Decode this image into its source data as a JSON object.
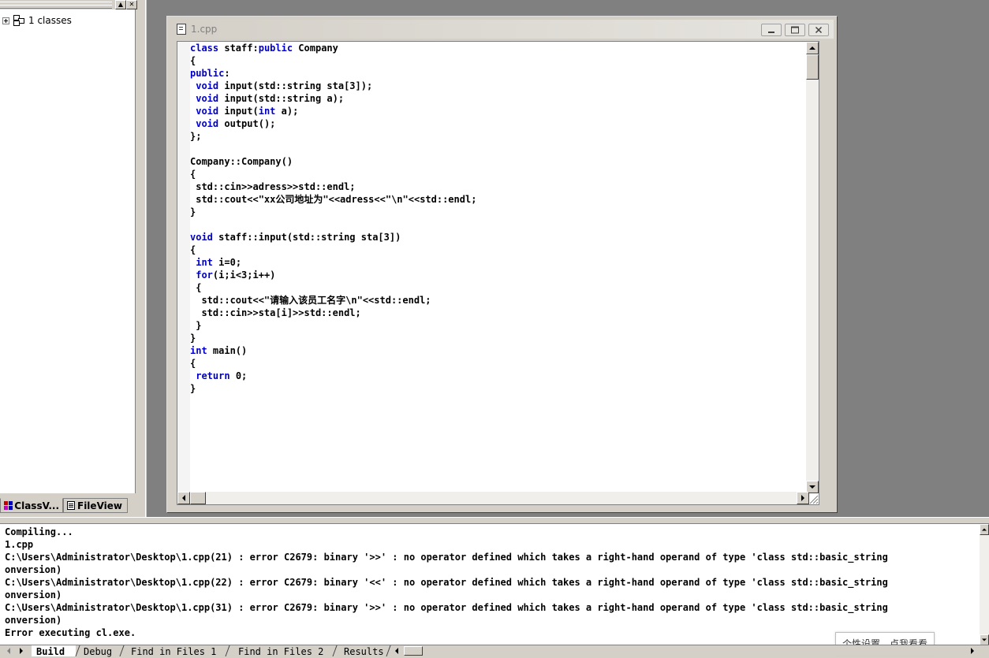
{
  "workspace": {
    "tree_root_label": "1 classes",
    "tabs": [
      {
        "label": "ClassV..."
      },
      {
        "label": "FileView"
      }
    ],
    "close_glyph": "✕",
    "restore_glyph": "▲"
  },
  "editor": {
    "window_title": "1.cpp",
    "code_lines": [
      [
        {
          "t": "class ",
          "k": true
        },
        {
          "t": "staff:",
          "k": false
        },
        {
          "t": "public",
          "k": true
        },
        {
          "t": " Company",
          "k": false
        }
      ],
      [
        {
          "t": "{",
          "k": false
        }
      ],
      [
        {
          "t": "public",
          "k": true
        },
        {
          "t": ":",
          "k": false
        }
      ],
      [
        {
          "t": " ",
          "k": false
        },
        {
          "t": "void",
          "k": true
        },
        {
          "t": " input(std::string sta[3]);",
          "k": false
        }
      ],
      [
        {
          "t": " ",
          "k": false
        },
        {
          "t": "void",
          "k": true
        },
        {
          "t": " input(std::string a);",
          "k": false
        }
      ],
      [
        {
          "t": " ",
          "k": false
        },
        {
          "t": "void",
          "k": true
        },
        {
          "t": " input(",
          "k": false
        },
        {
          "t": "int",
          "k": true
        },
        {
          "t": " a);",
          "k": false
        }
      ],
      [
        {
          "t": " ",
          "k": false
        },
        {
          "t": "void",
          "k": true
        },
        {
          "t": " output();",
          "k": false
        }
      ],
      [
        {
          "t": "};",
          "k": false
        }
      ],
      [
        {
          "t": "",
          "k": false
        }
      ],
      [
        {
          "t": "Company::Company()",
          "k": false
        }
      ],
      [
        {
          "t": "{",
          "k": false
        }
      ],
      [
        {
          "t": " std::cin>>adress>>std::endl;",
          "k": false
        }
      ],
      [
        {
          "t": " std::cout<<\"xx公司地址为\"<<adress<<\"\\n\"<<std::endl;",
          "k": false
        }
      ],
      [
        {
          "t": "}",
          "k": false
        }
      ],
      [
        {
          "t": "",
          "k": false
        }
      ],
      [
        {
          "t": "void",
          "k": true
        },
        {
          "t": " staff::input(std::string sta[3])",
          "k": false
        }
      ],
      [
        {
          "t": "{",
          "k": false
        }
      ],
      [
        {
          "t": " ",
          "k": false
        },
        {
          "t": "int",
          "k": true
        },
        {
          "t": " i=0;",
          "k": false
        }
      ],
      [
        {
          "t": " ",
          "k": false
        },
        {
          "t": "for",
          "k": true
        },
        {
          "t": "(i;i<3;i++)",
          "k": false
        }
      ],
      [
        {
          "t": " {",
          "k": false
        }
      ],
      [
        {
          "t": "  std::cout<<\"请输入该员工名字\\n\"<<std::endl;",
          "k": false
        }
      ],
      [
        {
          "t": "  std::cin>>sta[i]>>std::endl;",
          "k": false
        }
      ],
      [
        {
          "t": " }",
          "k": false
        }
      ],
      [
        {
          "t": "}",
          "k": false
        }
      ],
      [
        {
          "t": "int",
          "k": true
        },
        {
          "t": " main()",
          "k": false
        }
      ],
      [
        {
          "t": "{",
          "k": false
        }
      ],
      [
        {
          "t": " ",
          "k": false
        },
        {
          "t": "return",
          "k": true
        },
        {
          "t": " 0;",
          "k": false
        }
      ],
      [
        {
          "t": "}",
          "k": false
        }
      ]
    ]
  },
  "output": {
    "lines": [
      "Compiling...",
      "1.cpp",
      "C:\\Users\\Administrator\\Desktop\\1.cpp(21) : error C2679: binary '>>' : no operator defined which takes a right-hand operand of type 'class std::basic_string",
      "onversion)",
      "C:\\Users\\Administrator\\Desktop\\1.cpp(22) : error C2679: binary '<<' : no operator defined which takes a right-hand operand of type 'class std::basic_string",
      "onversion)",
      "C:\\Users\\Administrator\\Desktop\\1.cpp(31) : error C2679: binary '>>' : no operator defined which takes a right-hand operand of type 'class std::basic_string",
      "onversion)",
      "Error executing cl.exe."
    ],
    "tabs": [
      "Build",
      "Debug",
      "Find in Files 1",
      "Find in Files 2",
      "Results"
    ],
    "popup_text": "个性设置，点我看看"
  },
  "colors": {
    "keyword": "#0000c8",
    "chrome": "#d4d0c8",
    "mdi_background": "#808080"
  }
}
